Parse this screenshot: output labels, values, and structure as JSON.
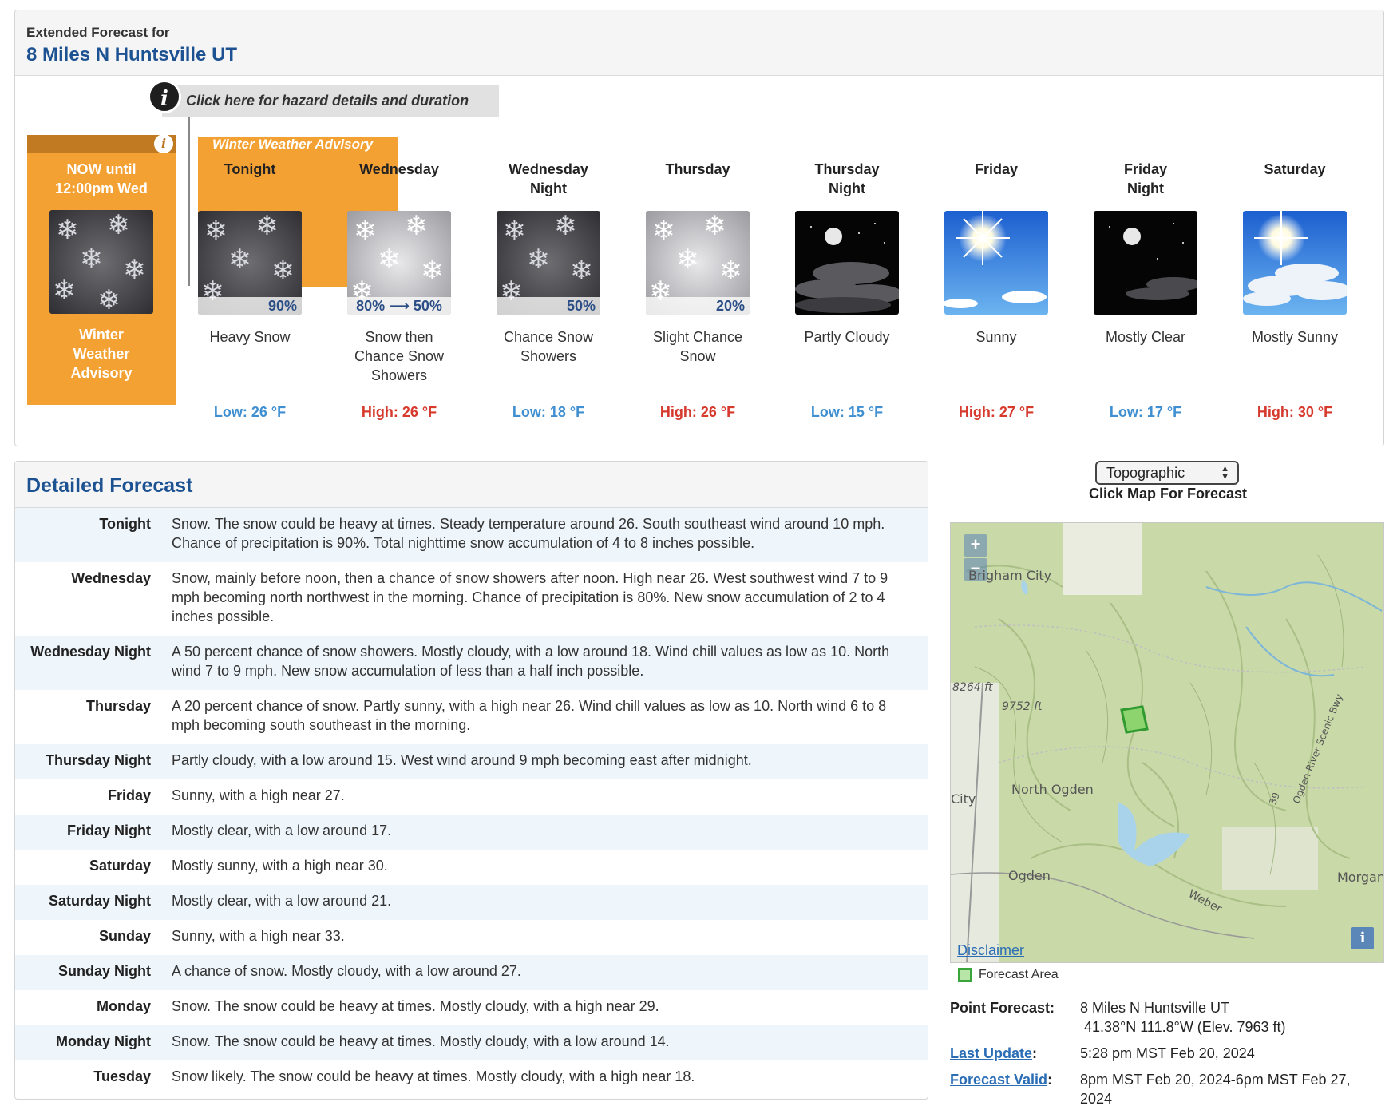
{
  "header": {
    "label": "Extended Forecast for",
    "location": "8 Miles N Huntsville UT"
  },
  "hazard": {
    "link_text": "Click here for hazard details and duration",
    "advisory_name": "Winter Weather Advisory",
    "now_until": "NOW until",
    "now_time": "12:00pm Wed",
    "now_label_1": "Winter",
    "now_label_2": "Weather",
    "now_label_3": "Advisory",
    "color": "#f4a133"
  },
  "periods": [
    {
      "name1": "Tonight",
      "name2": "",
      "pop": "90%",
      "desc1": "Heavy Snow",
      "desc2": "",
      "desc3": "",
      "temp": "Low: 26 °F",
      "kind": "low",
      "icon": "heavy-snow-icon"
    },
    {
      "name1": "Wednesday",
      "name2": "",
      "pop": "80% ⟶ 50%",
      "desc1": "Snow then",
      "desc2": "Chance Snow",
      "desc3": "Showers",
      "temp": "High: 26 °F",
      "kind": "high",
      "icon": "snow-icon"
    },
    {
      "name1": "Wednesday",
      "name2": "Night",
      "pop": "50%",
      "desc1": "Chance Snow",
      "desc2": "Showers",
      "desc3": "",
      "temp": "Low: 18 °F",
      "kind": "low",
      "icon": "snow-showers-icon"
    },
    {
      "name1": "Thursday",
      "name2": "",
      "pop": "20%",
      "desc1": "Slight Chance",
      "desc2": "Snow",
      "desc3": "",
      "temp": "High: 26 °F",
      "kind": "high",
      "icon": "light-snow-icon"
    },
    {
      "name1": "Thursday",
      "name2": "Night",
      "pop": "",
      "desc1": "Partly Cloudy",
      "desc2": "",
      "desc3": "",
      "temp": "Low: 15 °F",
      "kind": "low",
      "icon": "partly-cloudy-night-icon"
    },
    {
      "name1": "Friday",
      "name2": "",
      "pop": "",
      "desc1": "Sunny",
      "desc2": "",
      "desc3": "",
      "temp": "High: 27 °F",
      "kind": "high",
      "icon": "sunny-icon"
    },
    {
      "name1": "Friday",
      "name2": "Night",
      "pop": "",
      "desc1": "Mostly Clear",
      "desc2": "",
      "desc3": "",
      "temp": "Low: 17 °F",
      "kind": "low",
      "icon": "mostly-clear-night-icon"
    },
    {
      "name1": "Saturday",
      "name2": "",
      "pop": "",
      "desc1": "Mostly Sunny",
      "desc2": "",
      "desc3": "",
      "temp": "High: 30 °F",
      "kind": "high",
      "icon": "mostly-sunny-icon"
    }
  ],
  "colors": {
    "low": "#3f8fd1",
    "high": "#d63a2d",
    "title_blue": "#1c5292"
  },
  "detailed": {
    "title": "Detailed Forecast",
    "rows": [
      {
        "label": "Tonight",
        "text": "Snow. The snow could be heavy at times. Steady temperature around 26. South southeast wind around 10 mph. Chance of precipitation is 90%. Total nighttime snow accumulation of 4 to 8 inches possible."
      },
      {
        "label": "Wednesday",
        "text": "Snow, mainly before noon, then a chance of snow showers after noon. High near 26. West southwest wind 7 to 9 mph becoming north northwest in the morning. Chance of precipitation is 80%. New snow accumulation of 2 to 4 inches possible."
      },
      {
        "label": "Wednesday Night",
        "text": "A 50 percent chance of snow showers. Mostly cloudy, with a low around 18. Wind chill values as low as 10. North wind 7 to 9 mph. New snow accumulation of less than a half inch possible."
      },
      {
        "label": "Thursday",
        "text": "A 20 percent chance of snow. Partly sunny, with a high near 26. Wind chill values as low as 10. North wind 6 to 8 mph becoming south southeast in the morning."
      },
      {
        "label": "Thursday Night",
        "text": "Partly cloudy, with a low around 15. West wind around 9 mph becoming east after midnight."
      },
      {
        "label": "Friday",
        "text": "Sunny, with a high near 27."
      },
      {
        "label": "Friday Night",
        "text": "Mostly clear, with a low around 17."
      },
      {
        "label": "Saturday",
        "text": "Mostly sunny, with a high near 30."
      },
      {
        "label": "Saturday Night",
        "text": "Mostly clear, with a low around 21."
      },
      {
        "label": "Sunday",
        "text": "Sunny, with a high near 33."
      },
      {
        "label": "Sunday Night",
        "text": "A chance of snow. Mostly cloudy, with a low around 27."
      },
      {
        "label": "Monday",
        "text": "Snow. The snow could be heavy at times. Mostly cloudy, with a high near 29."
      },
      {
        "label": "Monday Night",
        "text": "Snow. The snow could be heavy at times. Mostly cloudy, with a low around 14."
      },
      {
        "label": "Tuesday",
        "text": "Snow likely. The snow could be heavy at times. Mostly cloudy, with a high near 18."
      }
    ]
  },
  "map": {
    "select_value": "Topographic",
    "caption": "Click Map For Forecast",
    "zoom_in": "+",
    "zoom_out": "−",
    "labels": {
      "brigham": "Brigham City",
      "elev1": "8264 ft",
      "elev2": "9752 ft",
      "north_ogden": "North Ogden",
      "city": "City",
      "ogden": "Ogden",
      "morgan": "Morgan",
      "weber": "Weber",
      "byway": "Ogden River Scenic Bwy",
      "route": "39"
    },
    "disclaimer": "Disclaimer",
    "info": "i",
    "legend": "Forecast Area"
  },
  "point_info": {
    "point_label": "Point Forecast",
    "point_value1": "8 Miles N Huntsville UT",
    "point_value2": "41.38°N 111.8°W (Elev. 7963 ft)",
    "update_label": "Last Update",
    "update_value": "5:28 pm MST Feb 20, 2024",
    "valid_label": "Forecast Valid",
    "valid_value1": "8pm MST Feb 20, 2024-6pm MST Feb 27,",
    "valid_value2": "2024"
  }
}
